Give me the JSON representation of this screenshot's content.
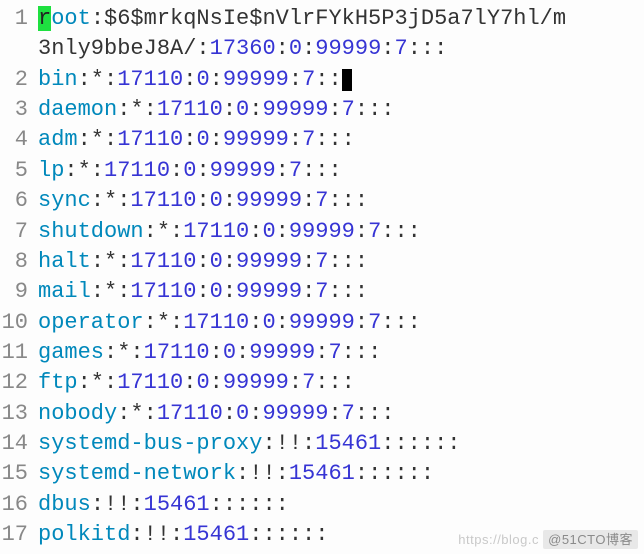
{
  "lines": [
    {
      "n": 1,
      "user": "root",
      "hash": "$6$mrkqNsIe$nVlrFYkH5P3jD5a7lY7hl/m",
      "wrap": "3nly9bbeJ8A/",
      "f1": "17360",
      "f2": "0",
      "f3": "99999",
      "f4": "7",
      "tail": ":::",
      "hlFirst": true
    },
    {
      "n": 2,
      "user": "bin",
      "pw": "*",
      "f1": "17110",
      "f2": "0",
      "f3": "99999",
      "f4": "7",
      "tail": "::",
      "cursor": true,
      "tail2": ""
    },
    {
      "n": 3,
      "user": "daemon",
      "pw": "*",
      "f1": "17110",
      "f2": "0",
      "f3": "99999",
      "f4": "7",
      "tail": ":::"
    },
    {
      "n": 4,
      "user": "adm",
      "pw": "*",
      "f1": "17110",
      "f2": "0",
      "f3": "99999",
      "f4": "7",
      "tail": ":::"
    },
    {
      "n": 5,
      "user": "lp",
      "pw": "*",
      "f1": "17110",
      "f2": "0",
      "f3": "99999",
      "f4": "7",
      "tail": ":::"
    },
    {
      "n": 6,
      "user": "sync",
      "pw": "*",
      "f1": "17110",
      "f2": "0",
      "f3": "99999",
      "f4": "7",
      "tail": ":::"
    },
    {
      "n": 7,
      "user": "shutdown",
      "pw": "*",
      "f1": "17110",
      "f2": "0",
      "f3": "99999",
      "f4": "7",
      "tail": ":::"
    },
    {
      "n": 8,
      "user": "halt",
      "pw": "*",
      "f1": "17110",
      "f2": "0",
      "f3": "99999",
      "f4": "7",
      "tail": ":::"
    },
    {
      "n": 9,
      "user": "mail",
      "pw": "*",
      "f1": "17110",
      "f2": "0",
      "f3": "99999",
      "f4": "7",
      "tail": ":::"
    },
    {
      "n": 10,
      "user": "operator",
      "pw": "*",
      "f1": "17110",
      "f2": "0",
      "f3": "99999",
      "f4": "7",
      "tail": ":::"
    },
    {
      "n": 11,
      "user": "games",
      "pw": "*",
      "f1": "17110",
      "f2": "0",
      "f3": "99999",
      "f4": "7",
      "tail": ":::"
    },
    {
      "n": 12,
      "user": "ftp",
      "pw": "*",
      "f1": "17110",
      "f2": "0",
      "f3": "99999",
      "f4": "7",
      "tail": ":::"
    },
    {
      "n": 13,
      "user": "nobody",
      "pw": "*",
      "f1": "17110",
      "f2": "0",
      "f3": "99999",
      "f4": "7",
      "tail": ":::"
    },
    {
      "n": 14,
      "user": "systemd-bus-proxy",
      "pw": "!!",
      "f1": "15461",
      "tail": "::::::"
    },
    {
      "n": 15,
      "user": "systemd-network",
      "pw": "!!",
      "f1": "15461",
      "tail": "::::::"
    },
    {
      "n": 16,
      "user": "dbus",
      "pw": "!!",
      "f1": "15461",
      "tail": "::::::"
    },
    {
      "n": 17,
      "user": "polkitd",
      "pw": "!!",
      "f1": "15461",
      "tail": "::::::",
      "partial": true
    }
  ],
  "watermark": {
    "prefix": "https://blog.c",
    "brand": "@51CTO博客"
  }
}
